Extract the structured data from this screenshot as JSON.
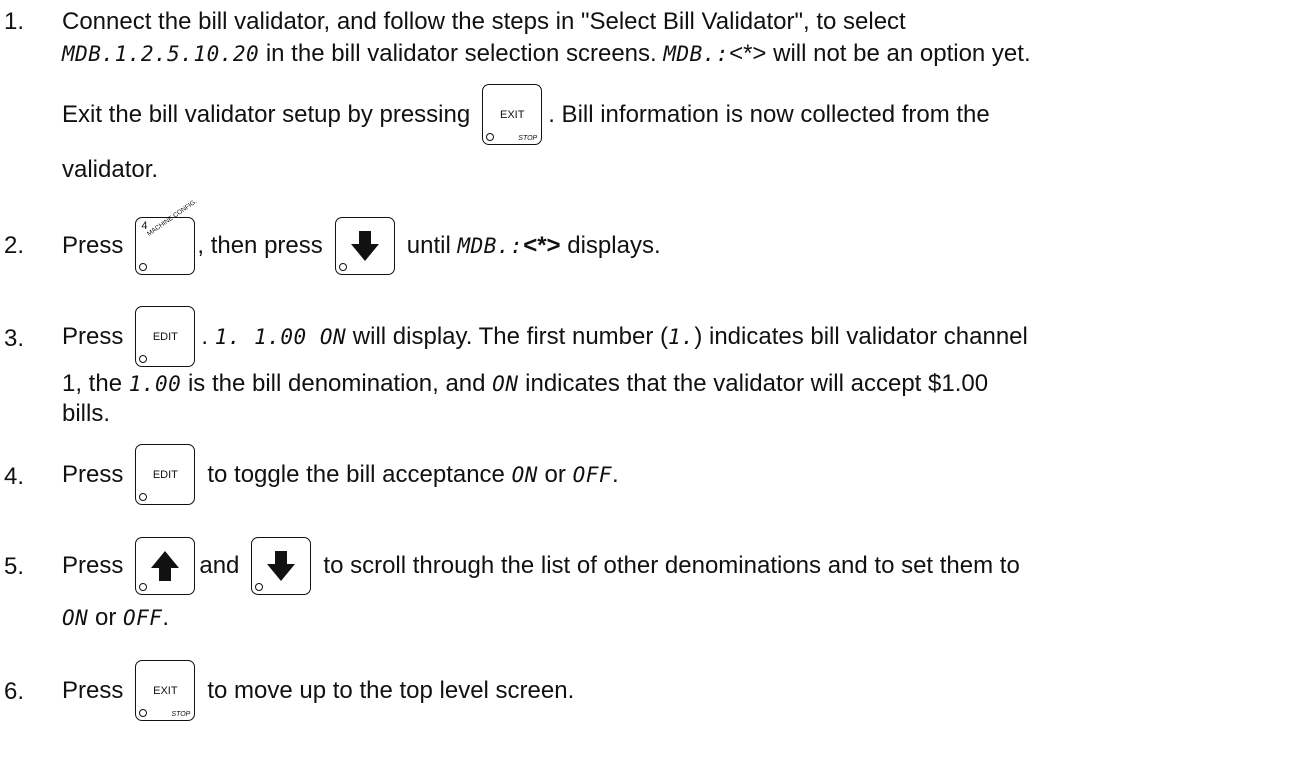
{
  "steps": [
    {
      "number": "1.",
      "line1": "Connect the bill validator, and follow the steps in \"Select Bill Validator\", to select",
      "line2_display": "MDB.1.2.5.10.20",
      "line2_text_a": " in the bill validator selection screens. ",
      "line2_display_b": "MDB.:",
      "line2_text_b": "<*> will not be an option yet.",
      "line3_text_a": "Exit the bill validator setup by pressing",
      "line3_text_b": ". Bill information is now collected from the",
      "line4": "validator."
    },
    {
      "number": "2.",
      "text_a": "Press",
      "text_b": ", then press",
      "text_c": "until",
      "display": "MDB.:",
      "display_bold": "<*>",
      "text_d": "displays."
    },
    {
      "number": "3.",
      "text_a": "Press",
      "text_b": ". ",
      "display_a": "1. 1.00 ON",
      "text_c": " will display. The first number (",
      "display_b": "1.",
      "text_d": ") indicates bill validator channel",
      "line2_a": "1, the ",
      "line2_display_a": "1.00",
      "line2_b": " is the bill denomination, and ",
      "line2_display_b": "ON",
      "line2_c": " indicates that the validator will accept $1.00",
      "line3": "bills."
    },
    {
      "number": "4.",
      "text_a": "Press",
      "text_b": "to toggle the bill acceptance ",
      "display_a": "ON",
      "text_c": " or ",
      "display_b": "OFF",
      "text_d": "."
    },
    {
      "number": "5.",
      "text_a": "Press",
      "text_b": "and",
      "text_c": "to scroll through the list of other denominations and to set them to",
      "line2_display_a": "ON",
      "line2_b": " or ",
      "line2_display_b": "OFF",
      "line2_c": "."
    },
    {
      "number": "6.",
      "text_a": "Press",
      "text_b": "to move up to the top level screen."
    }
  ],
  "keys": {
    "exit_label": "EXIT",
    "exit_sub": "STOP",
    "edit_label": "EDIT",
    "machine_config_digit": "4",
    "machine_config_label": "MACHINE CONFIG.",
    "arrow_up_icon": "arrow-up-icon",
    "arrow_down_icon": "arrow-down-icon"
  }
}
